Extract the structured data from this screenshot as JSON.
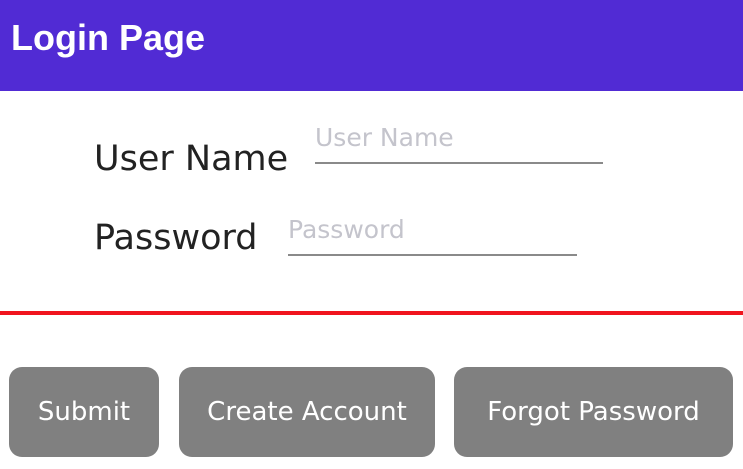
{
  "header": {
    "title": "Login Page"
  },
  "form": {
    "username_label": "User Name",
    "username_placeholder": "User Name",
    "password_label": "Password",
    "password_placeholder": "Password"
  },
  "actions": {
    "submit_label": "Submit",
    "create_account_label": "Create Account",
    "forgot_password_label": "Forgot Password"
  },
  "colors": {
    "header_background": "#512bd4",
    "divider": "#f0141e",
    "button_background": "#808080"
  }
}
